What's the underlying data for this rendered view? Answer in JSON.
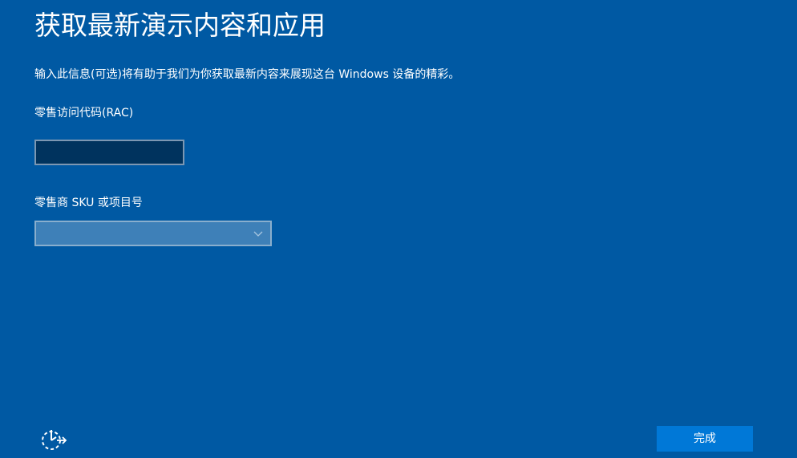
{
  "page": {
    "title": "获取最新演示内容和应用",
    "description": "输入此信息(可选)将有助于我们为你获取最新内容来展现这台 Windows 设备的精彩。"
  },
  "form": {
    "rac": {
      "label": "零售访问代码(RAC)",
      "value": "",
      "placeholder": ""
    },
    "sku": {
      "label": "零售商 SKU 或项目号",
      "selected": ""
    }
  },
  "footer": {
    "accessibility_icon": "ease-of-access-icon",
    "done_label": "完成"
  },
  "colors": {
    "background": "#0059a3",
    "input_background": "#00335e",
    "select_background": "#3e80b8",
    "accent": "#0078d7"
  }
}
